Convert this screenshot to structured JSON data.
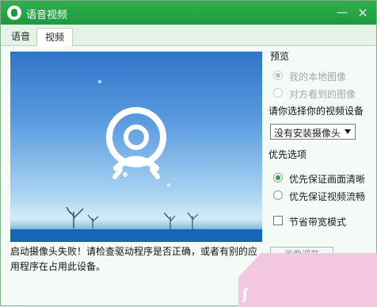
{
  "window": {
    "title": "语音视频",
    "minimize_symbol": "—",
    "close_symbol": "×"
  },
  "tabs": [
    {
      "label": "语音"
    },
    {
      "label": "视频"
    }
  ],
  "video": {
    "error_message": "启动摄像头失败！请检查驱动程序是否正确，或者有别的应用程序在占用此设备。"
  },
  "right_panel": {
    "preview_label": "预览",
    "preview_options": [
      {
        "label": "我的本地图像",
        "checked": true,
        "disabled": true
      },
      {
        "label": "对方看到的图像",
        "checked": false,
        "disabled": true
      }
    ],
    "device_label": "请你选择你的视频设备",
    "device_select": "没有安装摄像头",
    "priority_label": "优先选项",
    "priority_options": [
      {
        "label": "优先保证画面清晰",
        "checked": true
      },
      {
        "label": "优先保证视频流畅",
        "checked": false
      }
    ],
    "bandwidth_checkbox": "节省带宽模式",
    "cut_button": "画像调节"
  },
  "colors": {
    "title_green": "#1e9a3e",
    "sky_blue": "#2f74c9",
    "watermark_pink": "#f3c7df"
  }
}
